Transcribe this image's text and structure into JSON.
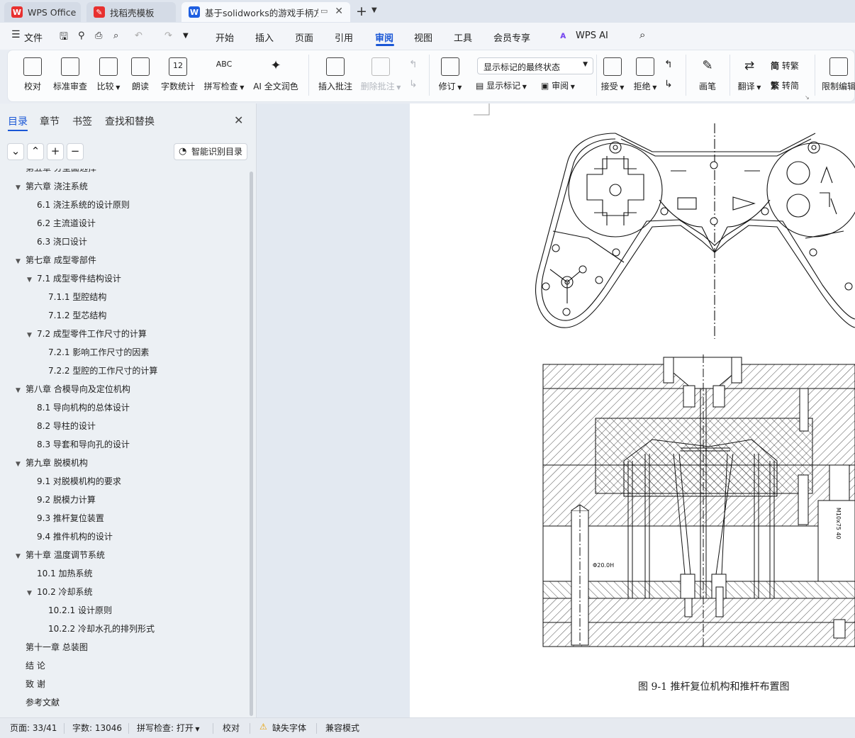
{
  "tabs": [
    {
      "label": "WPS Office",
      "color": "#e8302f"
    },
    {
      "label": "找稻壳模板",
      "color": "#e8302f"
    },
    {
      "label": "基于solidworks的游戏手柄方",
      "color": "#1f5fe0"
    }
  ],
  "menu": {
    "file": "文件",
    "items": [
      "开始",
      "插入",
      "页面",
      "引用",
      "审阅",
      "视图",
      "工具",
      "会员专享"
    ],
    "ai": "WPS AI"
  },
  "ribbon": {
    "proof": "校对",
    "std_review": "标准审查",
    "compare": "比较",
    "read_aloud": "朗读",
    "word_count": "字数统计",
    "spell_check": "拼写检查",
    "ai_polish": "AI 全文润色",
    "insert_comment": "插入批注",
    "delete_comment": "删除批注",
    "revise": "修订",
    "markup_select": "显示标记的最终状态",
    "show_markup": "显示标记",
    "review": "审阅",
    "accept": "接受",
    "reject": "拒绝",
    "pen": "画笔",
    "translate": "翻译",
    "to_trad": "转繁",
    "to_simp": "转简",
    "restrict_edit": "限制编辑",
    "count_icon_text": "12",
    "abc_icon_text": "ABC",
    "trad_char": "简",
    "simp_char": "繁"
  },
  "sidebar": {
    "tabs": [
      "目录",
      "章节",
      "书签",
      "查找和替换"
    ],
    "smart_button": "智能识别目录",
    "toc": [
      {
        "text": "第五章 分型面选择",
        "level": 1,
        "arrow": false
      },
      {
        "text": "第六章 浇注系统",
        "level": 1,
        "arrow": true
      },
      {
        "text": "6.1 浇注系统的设计原则",
        "level": 2,
        "arrow": false
      },
      {
        "text": "6.2 主流道设计",
        "level": 2,
        "arrow": false
      },
      {
        "text": "6.3 浇口设计",
        "level": 2,
        "arrow": false
      },
      {
        "text": "第七章 成型零部件",
        "level": 1,
        "arrow": true
      },
      {
        "text": "7.1 成型零件结构设计",
        "level": 2,
        "arrow": true
      },
      {
        "text": "7.1.1 型腔结构",
        "level": 3,
        "arrow": false
      },
      {
        "text": "7.1.2 型芯结构",
        "level": 3,
        "arrow": false
      },
      {
        "text": "7.2 成型零件工作尺寸的计算",
        "level": 2,
        "arrow": true
      },
      {
        "text": "7.2.1 影响工作尺寸的因素",
        "level": 3,
        "arrow": false
      },
      {
        "text": "7.2.2 型腔的工作尺寸的计算",
        "level": 3,
        "arrow": false
      },
      {
        "text": "第八章 合模导向及定位机构",
        "level": 1,
        "arrow": true
      },
      {
        "text": "8.1 导向机构的总体设计",
        "level": 2,
        "arrow": false
      },
      {
        "text": "8.2 导柱的设计",
        "level": 2,
        "arrow": false
      },
      {
        "text": "8.3 导套和导向孔的设计",
        "level": 2,
        "arrow": false
      },
      {
        "text": "第九章 脱模机构",
        "level": 1,
        "arrow": true
      },
      {
        "text": "9.1 对脱模机构的要求",
        "level": 2,
        "arrow": false
      },
      {
        "text": "9.2 脱模力计算",
        "level": 2,
        "arrow": false
      },
      {
        "text": "9.3 推杆复位装置",
        "level": 2,
        "arrow": false
      },
      {
        "text": "9.4 推件机构的设计",
        "level": 2,
        "arrow": false
      },
      {
        "text": "第十章 温度调节系统",
        "level": 1,
        "arrow": true
      },
      {
        "text": "10.1 加热系统",
        "level": 2,
        "arrow": false
      },
      {
        "text": "10.2 冷却系统",
        "level": 2,
        "arrow": true
      },
      {
        "text": "10.2.1 设计原则",
        "level": 3,
        "arrow": false
      },
      {
        "text": "10.2.2 冷却水孔的排列形式",
        "level": 3,
        "arrow": false
      },
      {
        "text": "第十一章 总装图",
        "level": 1,
        "arrow": false
      },
      {
        "text": "结 论",
        "level": 1,
        "arrow": false
      },
      {
        "text": "致 谢",
        "level": 1,
        "arrow": false
      },
      {
        "text": "参考文献",
        "level": 1,
        "arrow": false
      }
    ]
  },
  "document": {
    "caption": "图 9-1 推杆复位机构和推杆布置图",
    "dim_label": "Φ20.0H",
    "side_label": "M10x75 40"
  },
  "status": {
    "page": "页面: 33/41",
    "words": "字数: 13046",
    "spell": "拼写检查: 打开",
    "proof": "校对",
    "missing_font": "缺失字体",
    "compat": "兼容模式"
  }
}
